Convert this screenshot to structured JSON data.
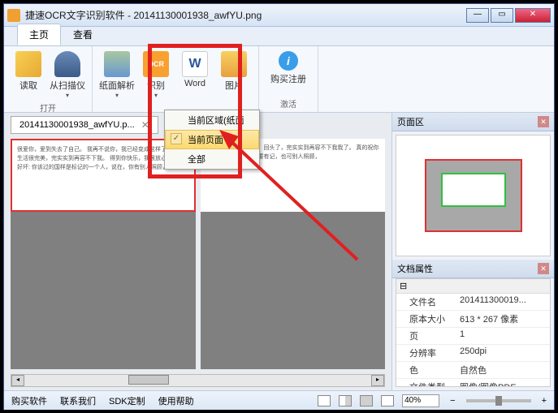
{
  "title": "捷速OCR文字识别软件 - 20141130001938_awfYU.png",
  "tabs": {
    "main": "主页",
    "view": "查看"
  },
  "ribbon": {
    "read": "读取",
    "scanner": "从扫描仪",
    "parse": "纸面解析",
    "ocr_top": "OCR",
    "ocr": "识别",
    "word": "Word",
    "word_glyph": "W",
    "pic": "图片",
    "buy": "购买注册",
    "grp_open": "打开",
    "grp_activate": "激活"
  },
  "menu": {
    "region": "当前区域(纸面",
    "page": "当前页面",
    "all": "全部",
    "check": "✓"
  },
  "file_tab": "20141130001938_awfYU.p...",
  "doc_left": "很爱你，爱到失去了自己。\n\n我再不说你，我已经变成这样了。\n\n你的生活很完美，完实实到再容不下我。\n\n得到你快乐，我很放心。\n\n记住好坏: 你该过的国样是标记的一个人，说在，你有别人照顾，",
  "doc_right": "别人面前很美了自己。\n\n回头了，完实实到再容不下我我了。\n\n真的祝你快乐，我放心。\n\n你看要有记，也可别人照顾，",
  "right": {
    "preview": "页面区",
    "props_title": "文档属性",
    "group": "⊟",
    "items": [
      {
        "k": "文件名",
        "v": "201411300019..."
      },
      {
        "k": "原本大小",
        "v": "613 * 267 像素"
      },
      {
        "k": "页",
        "v": "1"
      },
      {
        "k": "分辨率",
        "v": "250dpi"
      },
      {
        "k": "色",
        "v": "自然色"
      },
      {
        "k": "文件类型",
        "v": "图像/图像PDF"
      }
    ]
  },
  "status": {
    "buy": "购买软件",
    "contact": "联系我们",
    "sdk": "SDK定制",
    "help": "使用帮助",
    "zoom": "40%",
    "minus": "−",
    "plus": "+"
  }
}
